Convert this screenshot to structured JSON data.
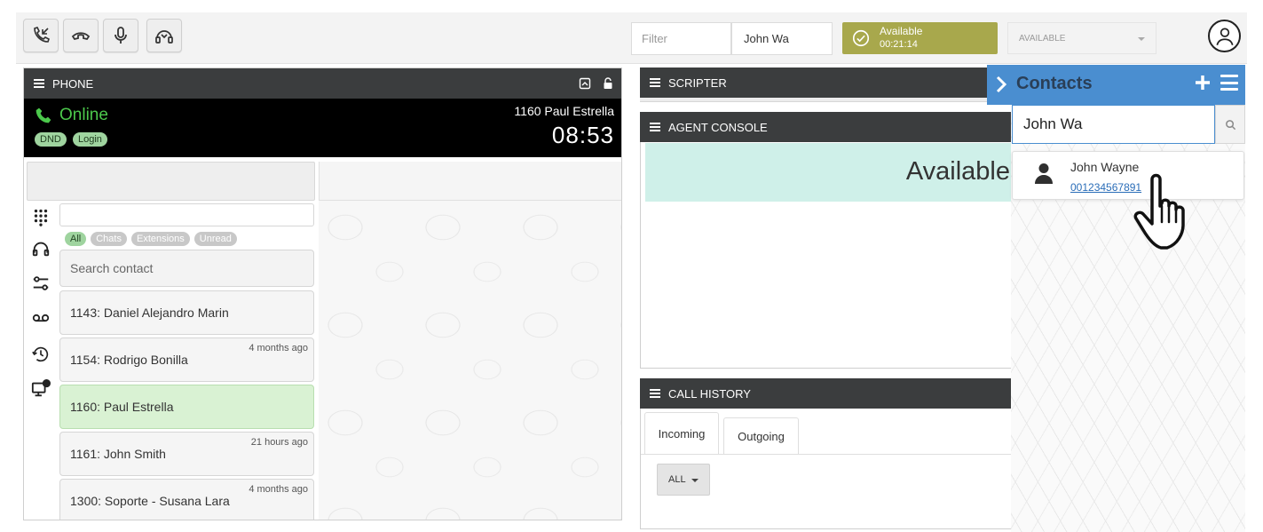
{
  "toolbar": {
    "buttons": [
      "transfer-call-icon",
      "hangup-icon",
      "microphone-icon",
      "headset-icon"
    ],
    "filter_placeholder": "Filter",
    "search_value": "John Wa",
    "status": {
      "label": "Available",
      "timer": "00:21:14",
      "color": "#a8a84c"
    },
    "availability_select": "AVAILABLE"
  },
  "phone": {
    "title": "PHONE",
    "status": "Online",
    "chips": [
      "DND",
      "Login"
    ],
    "extension": "1160 Paul Estrella",
    "timer": "08:53",
    "filters": [
      "All",
      "Chats",
      "Extensions",
      "Unread"
    ],
    "search_placeholder": "Search contact",
    "contacts": [
      {
        "name": "1143: Daniel Alejandro Marin",
        "time": ""
      },
      {
        "name": "1154: Rodrigo Bonilla",
        "time": "4 months ago"
      },
      {
        "name": "1160: Paul Estrella",
        "time": "",
        "selected": true
      },
      {
        "name": "1161: John Smith",
        "time": "21 hours ago"
      },
      {
        "name": "1300: Soporte - Susana Lara",
        "time": "4 months ago"
      }
    ]
  },
  "scripter": {
    "title": "SCRIPTER"
  },
  "agent_console": {
    "title": "AGENT CONSOLE",
    "status": "Available"
  },
  "call_history": {
    "title": "CALL HISTORY",
    "tabs": [
      "Incoming",
      "Outgoing"
    ],
    "filter": "ALL"
  },
  "contacts": {
    "title": "Contacts",
    "search_value": "John Wa",
    "results": [
      {
        "name": "John Wayne",
        "phone": "001234567891"
      }
    ],
    "accent": "#4a8ed0"
  }
}
